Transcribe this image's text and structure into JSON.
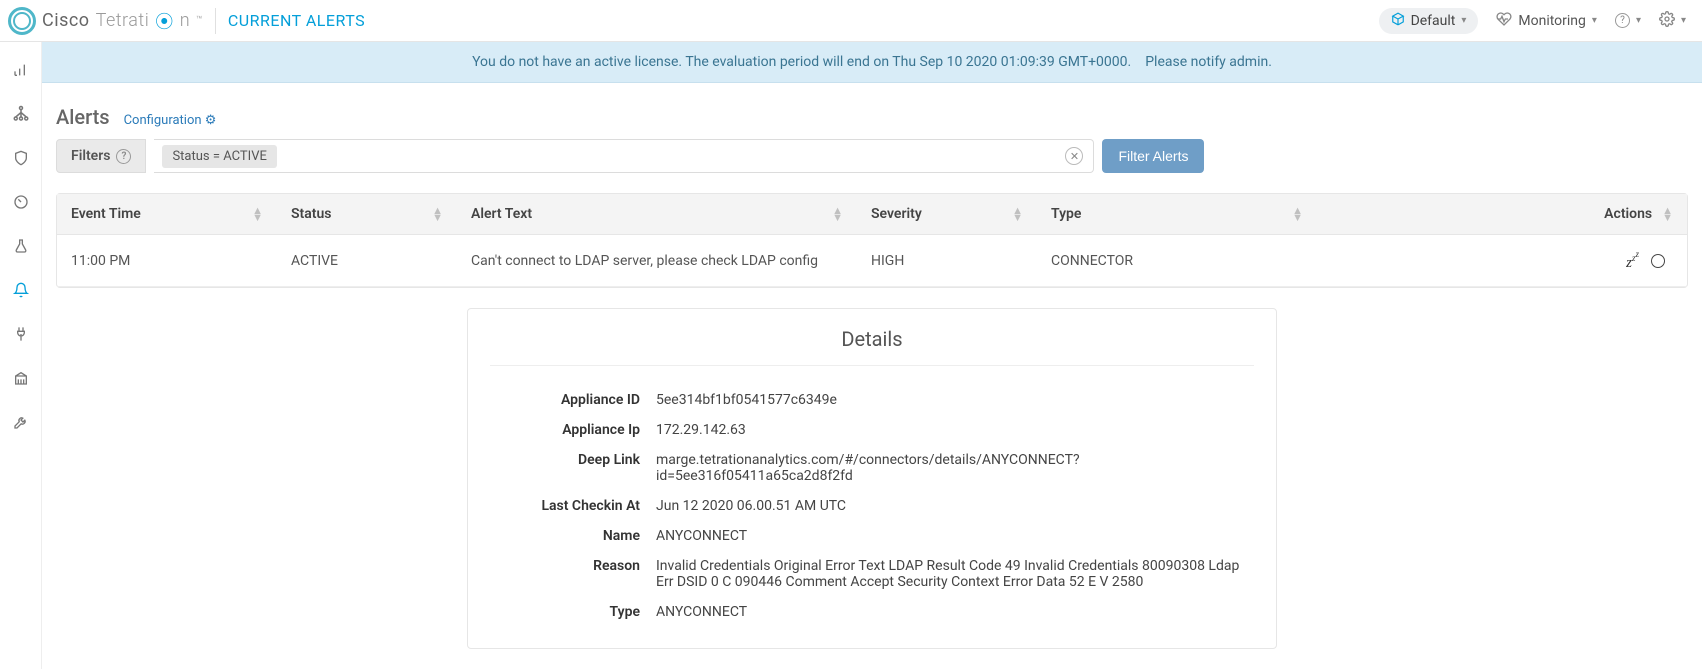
{
  "header": {
    "brand1": "Cisco",
    "brand2": "Tetrati",
    "brand3": "n",
    "page_title": "CURRENT ALERTS",
    "scope_label": "Default",
    "monitoring_label": "Monitoring"
  },
  "banner": {
    "text": "You do not have an active license. The evaluation period will end on Thu Sep 10 2020 01:09:39 GMT+0000.",
    "notify": "Please notify admin."
  },
  "page": {
    "heading": "Alerts",
    "config_link": "Configuration"
  },
  "filters": {
    "label": "Filters",
    "chip": "Status  =  ACTIVE",
    "button": "Filter Alerts"
  },
  "table": {
    "cols": {
      "event_time": "Event Time",
      "status": "Status",
      "alert_text": "Alert Text",
      "severity": "Severity",
      "type": "Type",
      "actions": "Actions"
    },
    "rows": [
      {
        "event_time": "11:00 PM",
        "status": "ACTIVE",
        "alert_text": "Can't connect to LDAP server, please check LDAP config",
        "severity": "HIGH",
        "type": "CONNECTOR"
      }
    ]
  },
  "details": {
    "title": "Details",
    "fields": {
      "appliance_id": {
        "label": "Appliance ID",
        "value": "5ee314bf1bf0541577c6349e"
      },
      "appliance_ip": {
        "label": "Appliance Ip",
        "value": "172.29.142.63"
      },
      "deep_link": {
        "label": "Deep Link",
        "value": "marge.tetrationanalytics.com/#/connectors/details/ANYCONNECT?id=5ee316f05411a65ca2d8f2fd"
      },
      "last_checkin": {
        "label": "Last Checkin At",
        "value": "Jun 12 2020 06.00.51 AM UTC"
      },
      "name": {
        "label": "Name",
        "value": "ANYCONNECT"
      },
      "reason": {
        "label": "Reason",
        "value": "Invalid Credentials Original Error Text LDAP Result Code 49 Invalid Credentials 80090308 Ldap Err DSID 0 C 090446 Comment Accept Security Context Error Data 52 E V 2580"
      },
      "type": {
        "label": "Type",
        "value": "ANYCONNECT"
      }
    }
  }
}
